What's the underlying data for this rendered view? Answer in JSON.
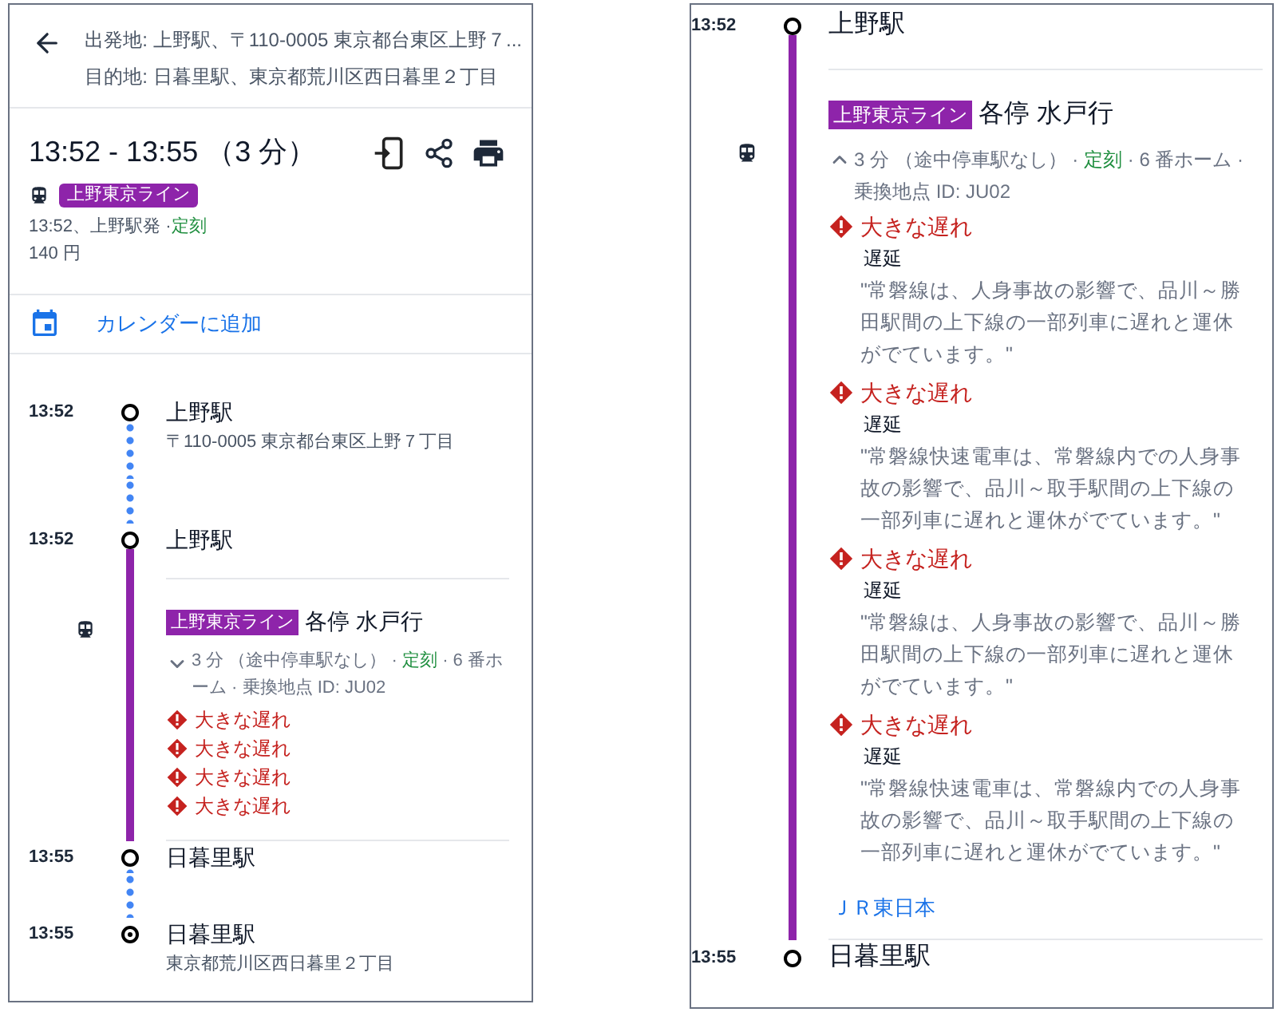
{
  "left": {
    "origin": "出発地: 上野駅、〒110-0005 東京都台東区上野７...",
    "destination": "目的地: 日暮里駅、東京都荒川区西日暮里２丁目",
    "summary": {
      "time": "13:52 - 13:55 （3 分）",
      "line_badge": "上野東京ライン",
      "departure": "13:52、上野駅発 ·",
      "status": "定刻",
      "fare": "140 円"
    },
    "calendar_link": "カレンダーに追加",
    "timeline": [
      {
        "kind": "stop",
        "time": "13:52",
        "name": "上野駅",
        "address": "〒110-0005 東京都台東区上野７丁目",
        "destination": false
      },
      {
        "kind": "walk"
      },
      {
        "kind": "stop",
        "time": "13:52",
        "name": "上野駅",
        "destination": false
      },
      {
        "kind": "transit",
        "line_badge": "上野東京ライン",
        "headsign": "各停 水戸行",
        "expanded": false,
        "duration": "3 分 （途中停車駅なし） ·",
        "status": "定刻",
        "details": "· 6 番ホーム · 乗換地点 ID: JU02",
        "alerts": [
          {
            "title": "大きな遅れ"
          },
          {
            "title": "大きな遅れ"
          },
          {
            "title": "大きな遅れ"
          },
          {
            "title": "大きな遅れ"
          }
        ]
      },
      {
        "kind": "stop",
        "time": "13:55",
        "name": "日暮里駅",
        "destination": false
      },
      {
        "kind": "walk"
      },
      {
        "kind": "stop",
        "time": "13:55",
        "name": "日暮里駅",
        "address": "東京都荒川区西日暮里２丁目",
        "destination": true
      }
    ]
  },
  "right": {
    "timeline": [
      {
        "kind": "stop",
        "time": "13:52",
        "name": "上野駅",
        "destination": false
      },
      {
        "kind": "transit",
        "line_badge": "上野東京ライン",
        "headsign": "各停 水戸行",
        "expanded": true,
        "duration": "3 分 （途中停車駅なし） ·",
        "status": "定刻",
        "details": "· 6 番ホーム · 乗換地点 ID: JU02",
        "alerts": [
          {
            "title": "大きな遅れ",
            "category": "遅延",
            "body": "\"常磐線は、人身事故の影響で、品川～勝田駅間の上下線の一部列車に遅れと運休がでています。\""
          },
          {
            "title": "大きな遅れ",
            "category": "遅延",
            "body": "\"常磐線快速電車は、常磐線内での人身事故の影響で、品川～取手駅間の上下線の一部列車に遅れと運休がでています。\""
          },
          {
            "title": "大きな遅れ",
            "category": "遅延",
            "body": "\"常磐線は、人身事故の影響で、品川～勝田駅間の上下線の一部列車に遅れと運休がでています。\""
          },
          {
            "title": "大きな遅れ",
            "category": "遅延",
            "body": "\"常磐線快速電車は、常磐線内での人身事故の影響で、品川～取手駅間の上下線の一部列車に遅れと運休がでています。\""
          }
        ],
        "operator": "ＪＲ東日本"
      },
      {
        "kind": "stop",
        "time": "13:55",
        "name": "日暮里駅",
        "destination": false
      }
    ]
  }
}
